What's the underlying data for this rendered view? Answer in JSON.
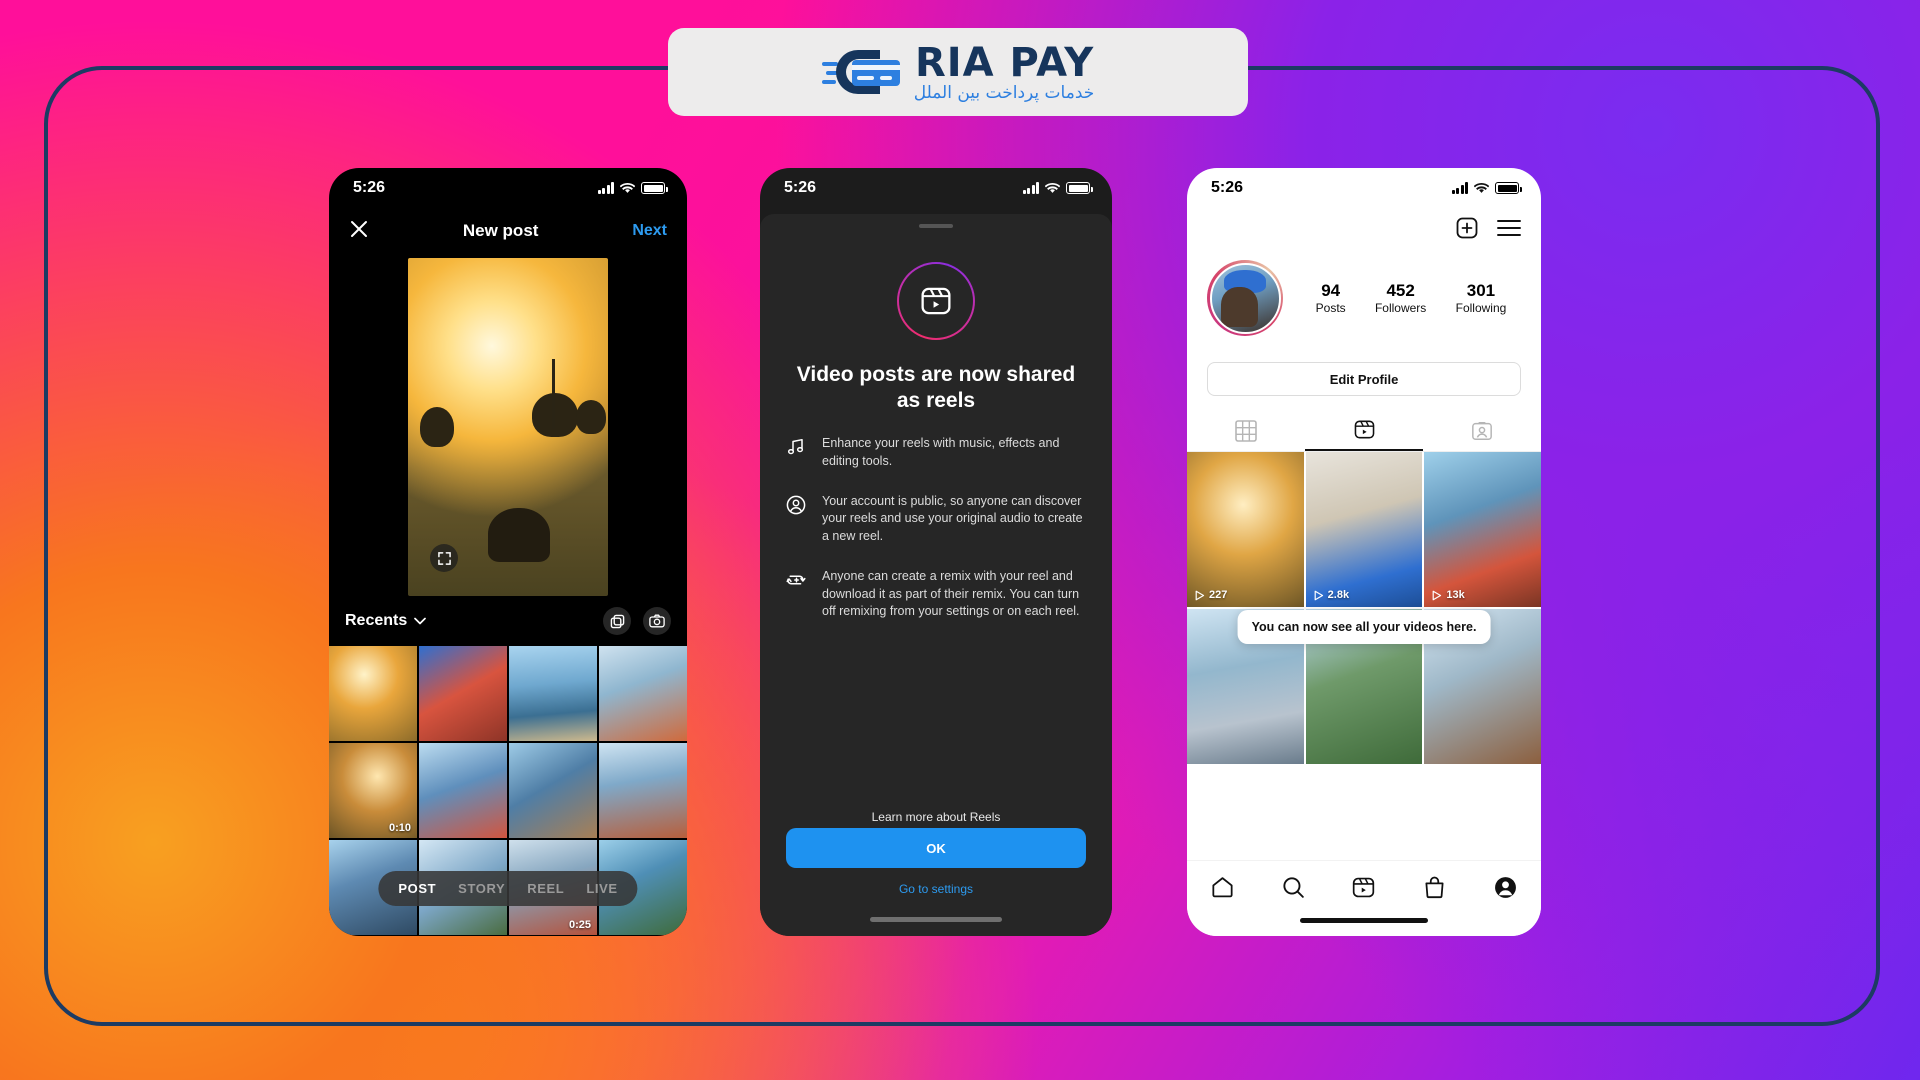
{
  "brand": {
    "name": "RIA PAY",
    "tagline": "خدمات پرداخت بین الملل",
    "logo_icon": "credit-card-speed-icon",
    "navy": "#16355c",
    "blue": "#2d7fe0"
  },
  "background": {
    "frame_border_color": "#1d3b63",
    "gradient_from": "#ff0f9a",
    "gradient_to": "#6f27ee",
    "accent_orange": "#f8a020"
  },
  "phone1": {
    "status": {
      "time": "5:26",
      "signal_icon": "signal-bars-icon",
      "wifi_icon": "wifi-icon",
      "battery_icon": "battery-full-icon"
    },
    "topbar": {
      "close_icon": "close-x-icon",
      "title": "New post",
      "next_label": "Next"
    },
    "preview": {
      "expand_icon": "expand-arrows-icon"
    },
    "gallery": {
      "album_label": "Recents",
      "chevron_icon": "chevron-down-icon",
      "multiselect_icon": "multi-select-icon",
      "camera_icon": "camera-icon"
    },
    "thumbs": [
      {
        "id": "t1",
        "duration": ""
      },
      {
        "id": "t2",
        "duration": ""
      },
      {
        "id": "t3",
        "duration": ""
      },
      {
        "id": "t4",
        "duration": ""
      },
      {
        "id": "t5",
        "duration": "0:10"
      },
      {
        "id": "t6",
        "duration": ""
      },
      {
        "id": "t7",
        "duration": ""
      },
      {
        "id": "t8",
        "duration": ""
      },
      {
        "id": "t9",
        "duration": ""
      },
      {
        "id": "t10",
        "duration": ""
      },
      {
        "id": "t11",
        "duration": "0:25"
      },
      {
        "id": "t12",
        "duration": ""
      },
      {
        "id": "t13",
        "duration": ""
      },
      {
        "id": "t14",
        "duration": ""
      },
      {
        "id": "t15",
        "duration": ""
      },
      {
        "id": "t16",
        "duration": ""
      }
    ],
    "modes": [
      {
        "label": "POST",
        "active": true
      },
      {
        "label": "STORY",
        "active": false
      },
      {
        "label": "REEL",
        "active": false
      },
      {
        "label": "LIVE",
        "active": false
      }
    ]
  },
  "phone2": {
    "status": {
      "time": "5:26",
      "signal_icon": "signal-bars-icon",
      "wifi_icon": "wifi-icon",
      "battery_icon": "battery-full-icon"
    },
    "badge_icon": "reels-icon",
    "heading": "Video posts are now shared as reels",
    "bullets": [
      {
        "icon": "music-note-icon",
        "text": "Enhance your reels with music, effects and editing tools."
      },
      {
        "icon": "account-circle-icon",
        "text": "Your account is public, so anyone can discover your reels and use your original audio to create a new reel."
      },
      {
        "icon": "remix-plus-icon",
        "text": "Anyone can create a remix with your reel and download it as part of their remix. You can turn off remixing from your settings or on each reel."
      }
    ],
    "learn_more": "Learn more about Reels",
    "ok_label": "OK",
    "ok_color": "#1e92f0",
    "settings_link": "Go to settings"
  },
  "phone3": {
    "status": {
      "time": "5:26",
      "signal_icon": "signal-bars-icon",
      "wifi_icon": "wifi-icon",
      "battery_icon": "battery-full-icon"
    },
    "actions": {
      "add_icon": "plus-box-icon",
      "menu_icon": "hamburger-menu-icon"
    },
    "avatar_icon": "profile-avatar",
    "stats": [
      {
        "number": "94",
        "label": "Posts"
      },
      {
        "number": "452",
        "label": "Followers"
      },
      {
        "number": "301",
        "label": "Following"
      }
    ],
    "edit_profile_label": "Edit Profile",
    "tabs": [
      {
        "icon": "grid-icon",
        "active": false
      },
      {
        "icon": "reels-icon",
        "active": true
      },
      {
        "icon": "tagged-icon",
        "active": false
      }
    ],
    "tooltip": "You can now see all your videos here.",
    "videos": [
      {
        "id": "v1",
        "views": "227",
        "play_icon": "play-icon"
      },
      {
        "id": "v2",
        "views": "2.8k",
        "play_icon": "play-icon"
      },
      {
        "id": "v3",
        "views": "13k",
        "play_icon": "play-icon"
      },
      {
        "id": "v4",
        "views": "",
        "play_icon": "play-icon"
      },
      {
        "id": "v5",
        "views": "",
        "play_icon": "play-icon"
      },
      {
        "id": "v6",
        "views": "",
        "play_icon": "play-icon"
      }
    ],
    "nav": [
      {
        "icon": "home-icon",
        "active": false
      },
      {
        "icon": "search-icon",
        "active": false
      },
      {
        "icon": "reels-icon",
        "active": false
      },
      {
        "icon": "shop-bag-icon",
        "active": false
      },
      {
        "icon": "profile-icon",
        "active": true
      }
    ]
  }
}
